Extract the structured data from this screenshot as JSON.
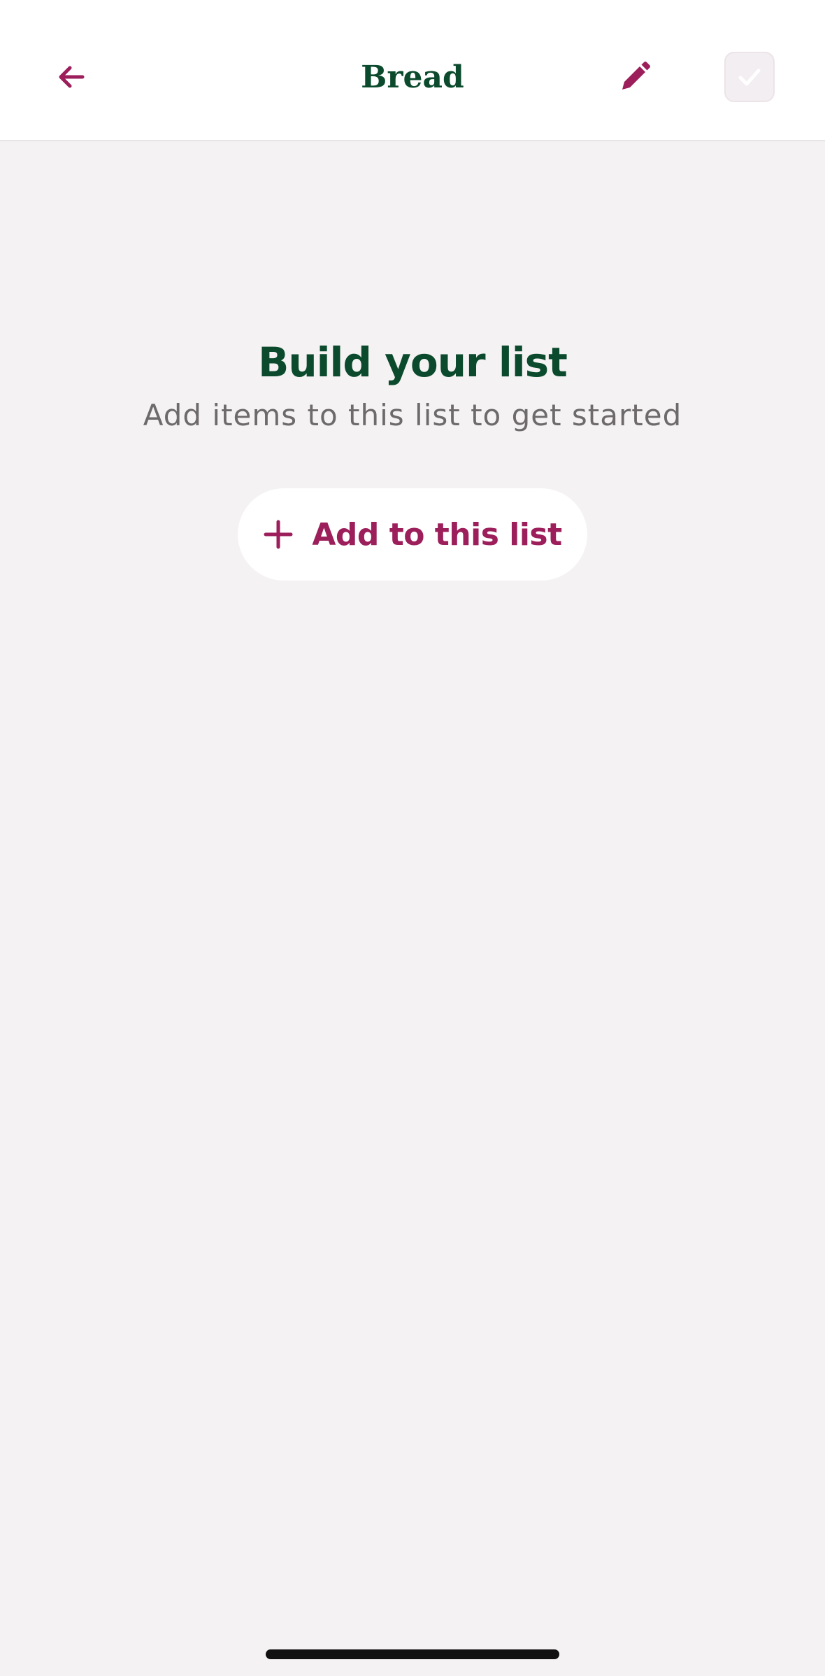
{
  "header": {
    "title": "Bread",
    "back_icon": "arrow-left-icon",
    "edit_icon": "pencil-icon",
    "done_icon": "checkmark-icon"
  },
  "empty_state": {
    "title": "Build your list",
    "subtitle": "Add items to this list to get started",
    "add_button_label": "Add to this list",
    "add_icon": "plus-icon"
  },
  "colors": {
    "brand_green": "#0b4a2c",
    "accent_magenta": "#9c1e5a",
    "background": "#f4f2f3",
    "header_background": "#ffffff",
    "subtitle_gray": "#6e6a6c"
  }
}
